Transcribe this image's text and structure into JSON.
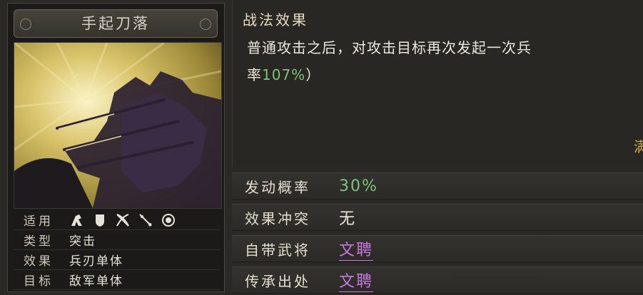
{
  "card": {
    "title": "手起刀落",
    "attrs": [
      {
        "key": "适用",
        "value": ""
      },
      {
        "key": "类型",
        "value": "突击"
      },
      {
        "key": "效果",
        "value": "兵刃单体"
      },
      {
        "key": "目标",
        "value": "敌军单体"
      }
    ],
    "unit_icons": [
      "cavalry-icon",
      "shield-icon",
      "bow-icon",
      "spear-icon",
      "siege-icon"
    ]
  },
  "effect": {
    "heading": "战法效果",
    "line1": "普通攻击之后，对攻击目标再次发起一次兵",
    "line2_prefix": "率",
    "line2_value": "107%",
    "line2_suffix": "）",
    "edge_char": "满"
  },
  "rows": [
    {
      "key": "发动概率",
      "value": "30%"
    },
    {
      "key": "效果冲突",
      "value": "无"
    },
    {
      "key": "自带武将",
      "value": "文聘"
    },
    {
      "key": "传承出处",
      "value": "文聘"
    }
  ],
  "colors": {
    "accent_green": "#7cc47a",
    "accent_purple": "#c777e0"
  }
}
